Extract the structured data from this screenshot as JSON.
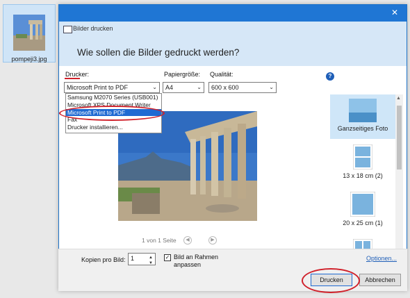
{
  "desktop": {
    "file_label": "pompeji3.jpg"
  },
  "dialog": {
    "title_label": "Bilder drucken",
    "question": "Wie sollen die Bilder gedruckt werden?",
    "close_glyph": "✕",
    "help_glyph": "?"
  },
  "options": {
    "printer_label": "Drucker:",
    "printer_value": "Microsoft Print to PDF",
    "paper_label": "Papiergröße:",
    "paper_value": "A4",
    "quality_label": "Qualität:",
    "quality_value": "600 x 600"
  },
  "printer_dropdown": {
    "items": [
      {
        "label": "Samsung M2070 Series (USB001)",
        "selected": false
      },
      {
        "label": "Microsoft XPS Document Writer",
        "selected": false
      },
      {
        "label": "Microsoft Print to PDF",
        "selected": true
      },
      {
        "label": "Fax",
        "selected": false
      },
      {
        "label": "Drucker installieren...",
        "selected": false
      }
    ]
  },
  "preview": {
    "page_text": "1 von 1 Seite",
    "prev_glyph": "◀",
    "next_glyph": "▶"
  },
  "layouts": {
    "items": [
      {
        "label": "Ganzseitiges Foto",
        "selected": true
      },
      {
        "label": "13 x 18 cm (2)",
        "selected": false
      },
      {
        "label": "20 x 25 cm (1)",
        "selected": false
      },
      {
        "label": "",
        "selected": false
      }
    ]
  },
  "bottom": {
    "copies_label": "Kopien pro Bild:",
    "copies_value": "1",
    "fit_label_line1": "Bild an Rahmen",
    "fit_label_line2": "anpassen",
    "fit_checked": true,
    "options_link": "Optionen...",
    "print_button": "Drucken",
    "cancel_button": "Abbrechen"
  },
  "colors": {
    "titlebar": "#1f76d4",
    "accent": "#1f6ad2",
    "highlight_ring": "#d0202a"
  }
}
